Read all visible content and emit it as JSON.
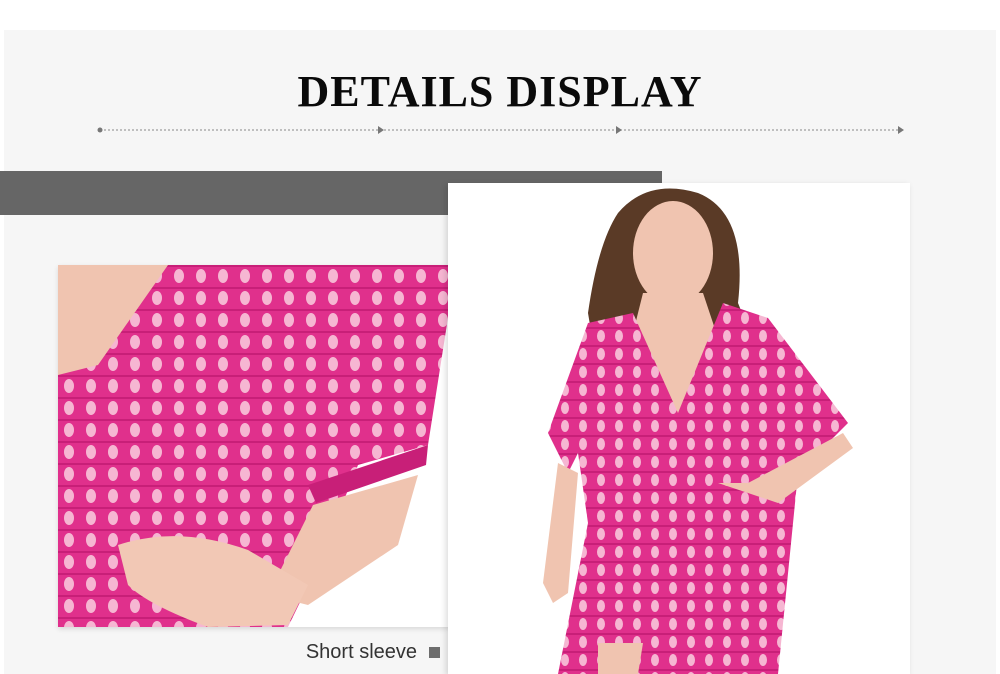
{
  "section": {
    "title": "DETAILS DISPLAY"
  },
  "detail": {
    "caption": "Short sleeve"
  },
  "colors": {
    "garment": "#e0308c",
    "garment_dark": "#b81a6a",
    "skin": "#f0c4b0",
    "hair": "#5a3a26",
    "gray_bar": "#666666",
    "title": "#0a0a0a"
  },
  "icons": {
    "caption_marker": "square-icon",
    "divider_arrows": "arrowhead-icon"
  }
}
